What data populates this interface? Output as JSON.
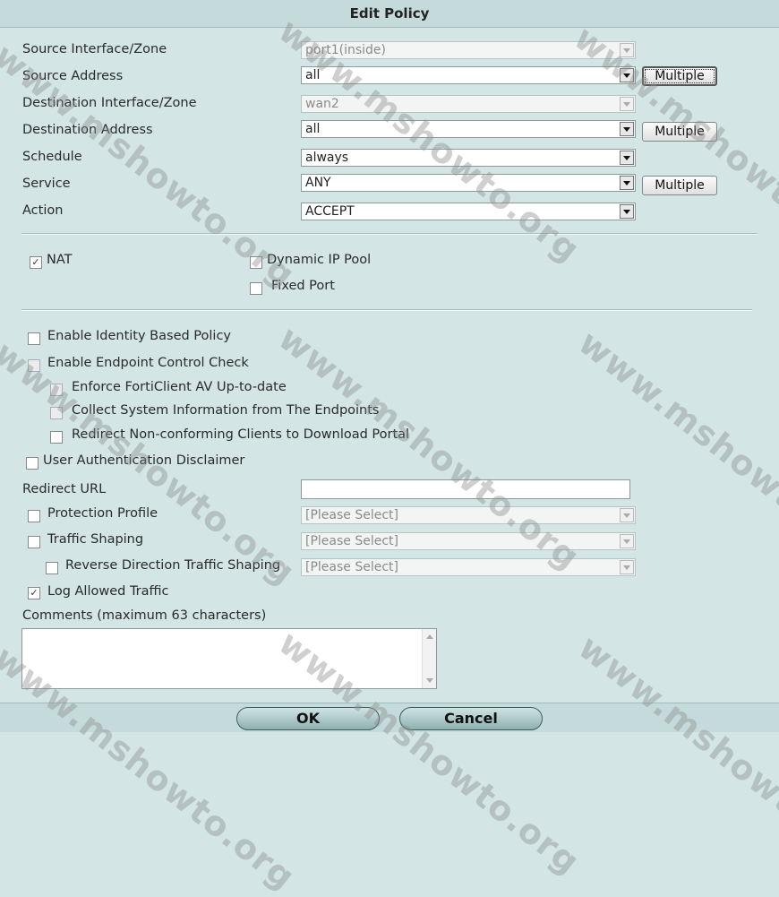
{
  "dialog": {
    "title": "Edit Policy",
    "fields": {
      "source_interface": {
        "label": "Source Interface/Zone",
        "value": "port1(inside)"
      },
      "source_address": {
        "label": "Source Address",
        "value": "all",
        "button": "Multiple"
      },
      "dest_interface": {
        "label": "Destination Interface/Zone",
        "value": "wan2"
      },
      "dest_address": {
        "label": "Destination Address",
        "value": "all",
        "button": "Multiple"
      },
      "schedule": {
        "label": "Schedule",
        "value": "always"
      },
      "service": {
        "label": "Service",
        "value": "ANY",
        "button": "Multiple"
      },
      "action": {
        "label": "Action",
        "value": "ACCEPT"
      }
    },
    "nat": {
      "nat_label": "NAT",
      "nat_checked": true,
      "dynamic_ip_pool_label": "Dynamic IP Pool",
      "fixed_port_label": "Fixed Port"
    },
    "options": {
      "identity_policy": "Enable Identity Based Policy",
      "endpoint_check": "Enable Endpoint Control Check",
      "enforce_av": "Enforce FortiClient AV Up-to-date",
      "collect_info": "Collect System Information from The Endpoints",
      "redirect_clients": "Redirect Non-conforming Clients to Download Portal",
      "user_auth": "User Authentication Disclaimer",
      "redirect_url_label": "Redirect URL",
      "redirect_url_value": "",
      "protection_profile": {
        "label": "Protection Profile",
        "value": "[Please Select]"
      },
      "traffic_shaping": {
        "label": "Traffic Shaping",
        "value": "[Please Select]"
      },
      "reverse_shaping": {
        "label": "Reverse Direction Traffic Shaping",
        "value": "[Please Select]"
      },
      "log_allowed": {
        "label": "Log Allowed Traffic",
        "checked": true
      },
      "comments_label": "Comments (maximum 63 characters)",
      "comments_value": ""
    },
    "buttons": {
      "ok": "OK",
      "cancel": "Cancel"
    }
  },
  "watermark": "www.mshowto.org"
}
